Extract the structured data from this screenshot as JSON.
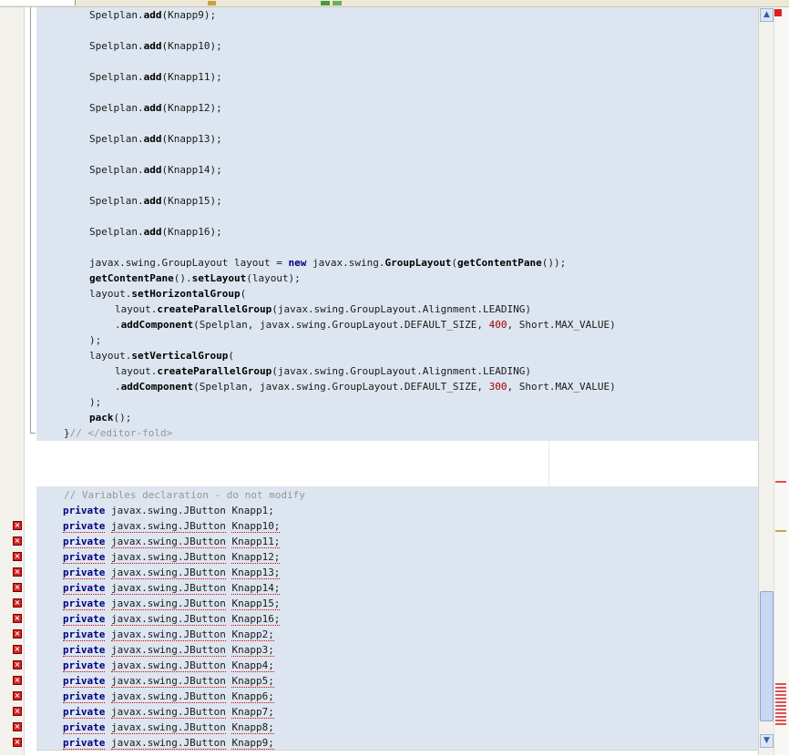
{
  "editor": {
    "code_top": [
      "Spelplan.add(Knapp9);",
      "Spelplan.add(Knapp10);",
      "Spelplan.add(Knapp11);",
      "Spelplan.add(Knapp12);",
      "Spelplan.add(Knapp13);",
      "Spelplan.add(Knapp14);",
      "Spelplan.add(Knapp15);",
      "Spelplan.add(Knapp16);"
    ],
    "layout_lines": {
      "l1": "javax.swing.GroupLayout layout = new javax.swing.GroupLayout(getContentPane());",
      "l2": "getContentPane().setLayout(layout);",
      "l3": "layout.setHorizontalGroup(",
      "l4": "layout.createParallelGroup(javax.swing.GroupLayout.Alignment.LEADING)",
      "l5": ".addComponent(Spelplan, javax.swing.GroupLayout.DEFAULT_SIZE, 400, Short.MAX_VALUE)",
      "l6": ");",
      "l7": "layout.setVerticalGroup(",
      "l8": "layout.createParallelGroup(javax.swing.GroupLayout.Alignment.LEADING)",
      "l9": ".addComponent(Spelplan, javax.swing.GroupLayout.DEFAULT_SIZE, 300, Short.MAX_VALUE)",
      "l10": ");",
      "l11": "pack();",
      "l12": "}// </editor-fold>"
    },
    "variables_comment": "// Variables declaration - do not modify",
    "declaration_keyword": "private",
    "declaration_type": "javax.swing.JButton",
    "declarations": [
      "Knapp1;",
      "Knapp10;",
      "Knapp11;",
      "Knapp12;",
      "Knapp13;",
      "Knapp14;",
      "Knapp15;",
      "Knapp16;",
      "Knapp2;",
      "Knapp3;",
      "Knapp4;",
      "Knapp5;",
      "Knapp6;",
      "Knapp7;",
      "Knapp8;",
      "Knapp9;"
    ],
    "error_icon_glyph": "×",
    "colors": {
      "guarded_background": "#dde6f0",
      "keyword": "#000080",
      "number": "#a00000",
      "comment": "#969696",
      "error": "#d62020"
    }
  },
  "scrollbar": {
    "up_arrow": "▲",
    "down_arrow": "▼"
  }
}
